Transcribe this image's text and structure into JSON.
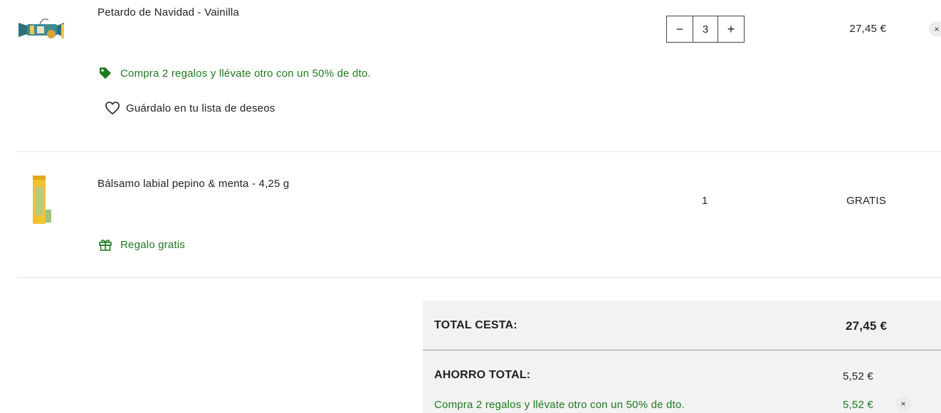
{
  "colors": {
    "promo_green": "#1f7a1f",
    "totals_background": "#f2f2f2"
  },
  "items": [
    {
      "name": "Petardo de Navidad - Vainilla",
      "image_icon": "christmas-cracker-product-image",
      "quantity": "3",
      "decrement_label": "−",
      "increment_label": "+",
      "price": "27,45 €",
      "promo_icon": "tag-icon",
      "promo": "Compra 2 regalos y llévate otro con un 50% de dto.",
      "wishlist_icon": "heart-icon",
      "wishlist": "Guárdalo en tu lista de deseos",
      "remove_label": "×"
    },
    {
      "name": "Bálsamo labial pepino & menta - 4,25 g",
      "image_icon": "lip-balm-product-image",
      "quantity": "1",
      "price": "GRATIS",
      "promo_icon": "gift-icon",
      "promo": "Regalo gratis"
    }
  ],
  "totals": {
    "basket_label": "TOTAL CESTA:",
    "basket_value": "27,45 €",
    "savings_label": "AHORRO TOTAL:",
    "savings_value": "5,52 €",
    "discount_label": "Compra 2 regalos y llévate otro con un 50% de dto.",
    "discount_value": "5,52 €",
    "discount_remove_label": "×"
  }
}
